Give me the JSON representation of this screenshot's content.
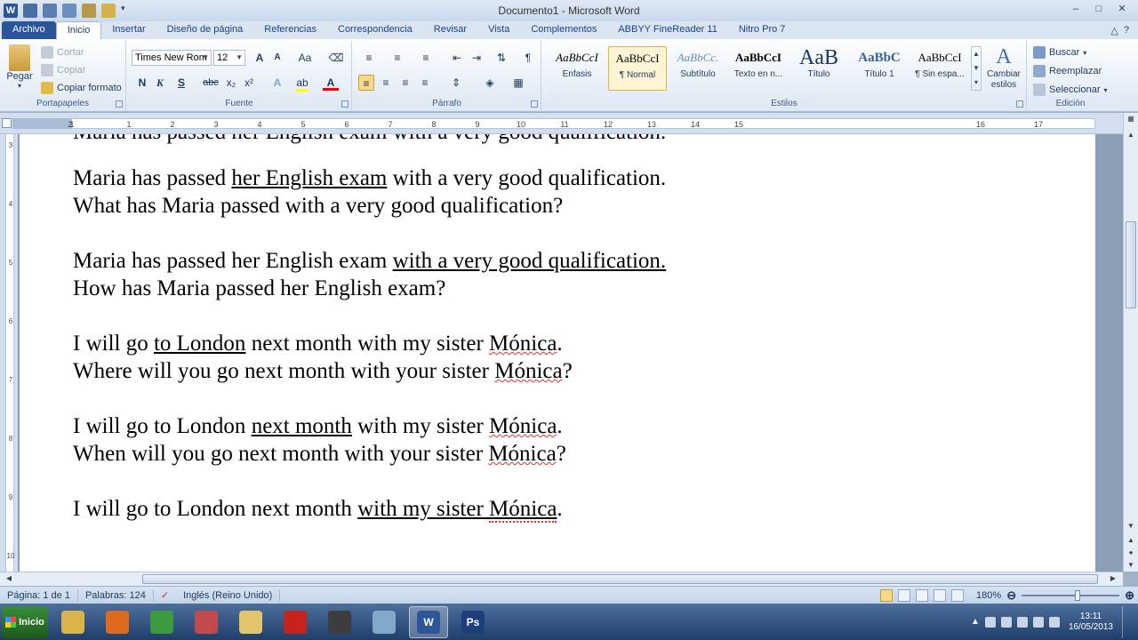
{
  "window": {
    "title": "Documento1  -  Microsoft Word",
    "qat_icons": [
      "word-logo-icon",
      "save-icon",
      "undo-icon",
      "redo-icon",
      "print-preview-icon",
      "open-folder-icon",
      "customize-qat-icon"
    ],
    "controls": [
      "minimize-icon",
      "maximize-icon",
      "close-icon"
    ]
  },
  "tabs": [
    "Archivo",
    "Inicio",
    "Insertar",
    "Diseño de página",
    "Referencias",
    "Correspondencia",
    "Revisar",
    "Vista",
    "Complementos",
    "ABBYY FineReader 11",
    "Nitro Pro 7"
  ],
  "active_tab": "Inicio",
  "ribbon": {
    "clipboard": {
      "label": "Portapapeles",
      "paste": "Pegar",
      "cut": "Cortar",
      "copy": "Copiar",
      "format_painter": "Copiar formato"
    },
    "font": {
      "label": "Fuente",
      "font_name": "Times New Rom",
      "font_size": "12",
      "bold": "N",
      "italic": "K",
      "underline": "S",
      "strike": "abc",
      "subscript": "x₂",
      "superscript": "x²",
      "grow": "A",
      "shrink": "A",
      "change_case": "Aa",
      "font_color": "A"
    },
    "paragraph": {
      "label": "Párrafo",
      "show_marks": "¶"
    },
    "styles": {
      "label": "Estilos",
      "items": [
        {
          "sample": "AaBbCcI",
          "name": "Énfasis"
        },
        {
          "sample": "AaBbCcI",
          "name": "¶ Normal"
        },
        {
          "sample": "AaBbCc.",
          "name": "Subtítulo"
        },
        {
          "sample": "AaBbCcI",
          "name": "Texto en n..."
        },
        {
          "sample": "AaB",
          "name": "Título"
        },
        {
          "sample": "AaBbC",
          "name": "Título 1"
        },
        {
          "sample": "AaBbCcI",
          "name": "¶ Sin espa..."
        }
      ],
      "selected": "¶ Normal",
      "change_styles": "Cambiar estilos"
    },
    "editing": {
      "label": "Edición",
      "find": "Buscar",
      "replace": "Reemplazar",
      "select": "Seleccionar"
    }
  },
  "ruler": {
    "ticks": [
      "2",
      "1",
      "1",
      "2",
      "3",
      "4",
      "5",
      "6",
      "7",
      "8",
      "9",
      "10",
      "11",
      "12",
      "13",
      "14",
      "15",
      "16",
      "17"
    ],
    "vticks": [
      "3",
      "4",
      "5",
      "6",
      "7",
      "8",
      "9",
      "10"
    ]
  },
  "document": {
    "cut_line": "Maria has passed her English exam with a very good qualification.",
    "paragraphs": [
      {
        "lines": [
          [
            {
              "t": "Maria has passed "
            },
            {
              "t": "her English exam",
              "u": true
            },
            {
              "t": " with a very good qualification."
            }
          ],
          [
            {
              "t": "What has Maria passed with a very good qualification?"
            }
          ]
        ]
      },
      {
        "lines": [
          [
            {
              "t": "Maria has passed her English exam "
            },
            {
              "t": "with a very good qualification.",
              "u": true
            }
          ],
          [
            {
              "t": "How has Maria passed her English exam?"
            }
          ]
        ]
      },
      {
        "lines": [
          [
            {
              "t": "I will go "
            },
            {
              "t": "to London",
              "u": true
            },
            {
              "t": " next month with my sister "
            },
            {
              "t": "Mónica",
              "sp": true
            },
            {
              "t": "."
            }
          ],
          [
            {
              "t": "Where will you go next month with your sister "
            },
            {
              "t": "Mónica",
              "sp": true
            },
            {
              "t": "?"
            }
          ]
        ]
      },
      {
        "lines": [
          [
            {
              "t": "I will go to London "
            },
            {
              "t": "next month",
              "u": true
            },
            {
              "t": " with my sister "
            },
            {
              "t": "Mónica",
              "sp": true
            },
            {
              "t": "."
            }
          ],
          [
            {
              "t": "When will you go next month with your sister "
            },
            {
              "t": "Mónica",
              "sp": true
            },
            {
              "t": "?"
            }
          ]
        ]
      },
      {
        "lines": [
          [
            {
              "t": "I will go to London next month "
            },
            {
              "t": "with my sister ",
              "u": true
            },
            {
              "t": "Mónica",
              "u": true,
              "sp": true
            },
            {
              "t": "."
            }
          ]
        ]
      }
    ]
  },
  "status": {
    "page": "Página: 1 de 1",
    "words": "Palabras: 124",
    "language": "Inglés (Reino Unido)",
    "zoom": "180%",
    "zoom_level_percent": 180
  },
  "taskbar": {
    "start_label": "Inicio",
    "apps": [
      {
        "icon": "file-explorer-icon",
        "color": "#d9b44a",
        "glyph": ""
      },
      {
        "icon": "firefox-icon",
        "color": "#e06a1b",
        "glyph": ""
      },
      {
        "icon": "chrome-icon",
        "color": "#3b9a3b",
        "glyph": ""
      },
      {
        "icon": "snipping-tool-icon",
        "color": "#c24a4a",
        "glyph": ""
      },
      {
        "icon": "folder-icon",
        "color": "#e2c56a",
        "glyph": ""
      },
      {
        "icon": "acrobat-icon",
        "color": "#c8221c",
        "glyph": ""
      },
      {
        "icon": "camera-icon",
        "color": "#3d3d3d",
        "glyph": ""
      },
      {
        "icon": "eraser-icon",
        "color": "#7fa8c9",
        "glyph": ""
      },
      {
        "icon": "word-icon",
        "color": "#2b579a",
        "glyph": "W",
        "active": true
      },
      {
        "icon": "photoshop-icon",
        "color": "#1c3f7a",
        "glyph": "Ps"
      }
    ],
    "time": "13:11",
    "date": "16/05/2013"
  },
  "colors": {
    "file_tab": "#2a5699",
    "spell_underline": "#e03030",
    "selected_style": "#fff5d6"
  }
}
